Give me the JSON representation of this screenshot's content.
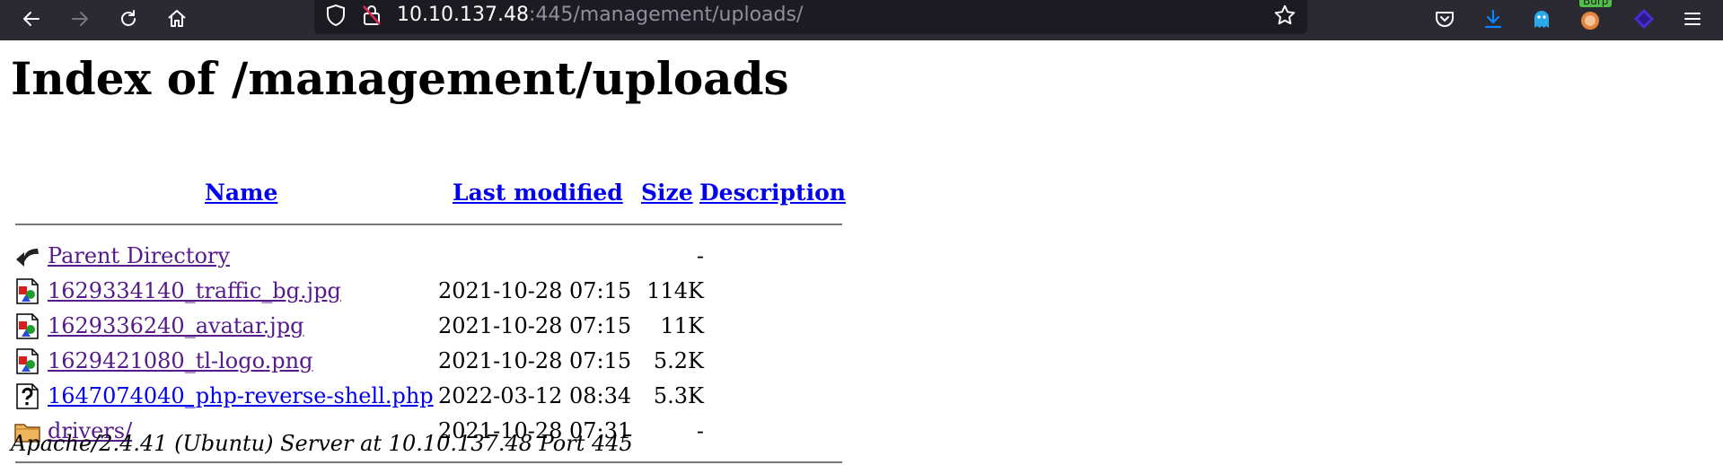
{
  "browser": {
    "url_host": "10.10.137.48",
    "url_rest": ":445/management/uploads/",
    "extension_badge": "Burp"
  },
  "page": {
    "title": "Index of /management/uploads",
    "columns": {
      "name": "Name",
      "last_modified": "Last modified",
      "size": "Size",
      "description": "Description"
    },
    "entries": [
      {
        "icon": "back-arrow-icon",
        "name": "Parent Directory",
        "modified": "",
        "size": "-"
      },
      {
        "icon": "image-file-icon",
        "name": "1629334140_traffic_bg.jpg",
        "modified": "2021-10-28 07:15",
        "size": "114K"
      },
      {
        "icon": "image-file-icon",
        "name": "1629336240_avatar.jpg",
        "modified": "2021-10-28 07:15",
        "size": "11K"
      },
      {
        "icon": "image-file-icon",
        "name": "1629421080_tl-logo.png",
        "modified": "2021-10-28 07:15",
        "size": "5.2K"
      },
      {
        "icon": "unknown-file-icon",
        "name": "1647074040_php-reverse-shell.php",
        "modified": "2022-03-12 08:34",
        "size": "5.3K"
      },
      {
        "icon": "folder-icon",
        "name": "drivers/",
        "modified": "2021-10-28 07:31",
        "size": "-"
      }
    ],
    "server_signature": "Apache/2.4.41 (Ubuntu) Server at 10.10.137.48 Port 445"
  },
  "colors": {
    "toolbar_bg": "#2b2a33",
    "urlbar_bg": "#1c1b22",
    "link": "#0000ee",
    "visited_link": "#551a8b",
    "download_icon": "#0b84ff",
    "ghost_icon": "#29a9e8"
  }
}
